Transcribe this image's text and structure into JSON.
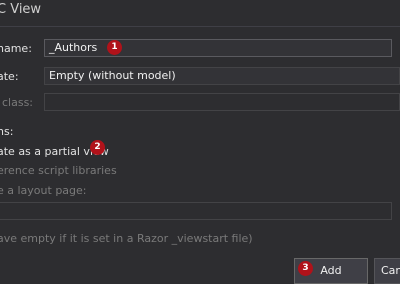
{
  "window": {
    "title": "C View"
  },
  "form": {
    "name_label": "name:",
    "name_value": "_Authors",
    "template_label": "ate:",
    "template_value": "Empty (without model)",
    "model_label": "class:",
    "options_label": "ns:",
    "partial_view_label": "ate as a partial view",
    "reference_scripts_label": "erence script libraries",
    "layout_label": "e a layout page:",
    "layout_value": "",
    "layout_hint": "ave empty if it is set in a Razor _viewstart file)"
  },
  "annotations": {
    "badge1": "1",
    "badge2": "2",
    "badge3": "3"
  },
  "buttons": {
    "add_label": "Add",
    "cancel_label": "Canc"
  },
  "colors": {
    "background": "#2d2d30",
    "input_background": "#333337",
    "badge": "#b0121a",
    "text": "#e2e2e2"
  }
}
